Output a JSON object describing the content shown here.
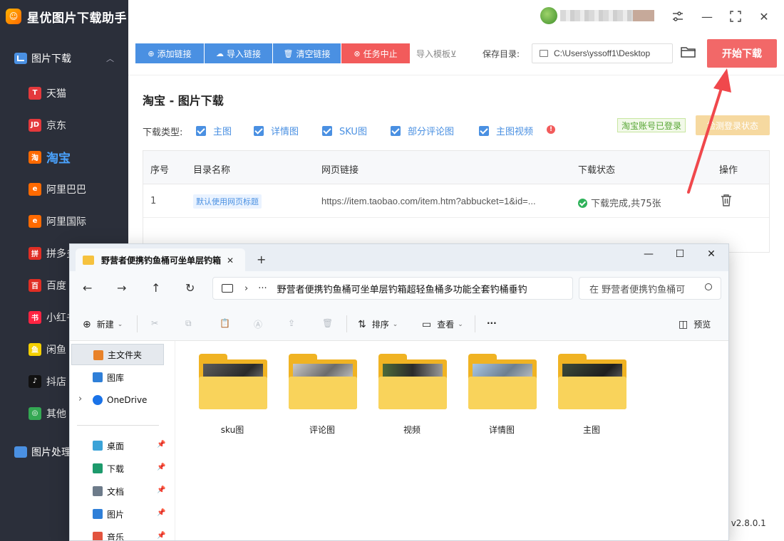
{
  "app": {
    "title": "星优图片下载助手",
    "version": "v2.8.0.1",
    "version_prefix": ":"
  },
  "sidebar": {
    "group_label": "图片下载",
    "items": [
      {
        "label": "天猫",
        "icon": "tmall-icon",
        "icon_text": "T",
        "color": "#e4393c"
      },
      {
        "label": "京东",
        "icon": "jd-icon",
        "icon_text": "JD",
        "color": "#e4393c"
      },
      {
        "label": "淘宝",
        "icon": "taobao-icon",
        "icon_text": "淘",
        "color": "#ff6a00"
      },
      {
        "label": "阿里巴巴",
        "icon": "alibaba-icon",
        "icon_text": "e",
        "color": "#ff6a00"
      },
      {
        "label": "阿里国际",
        "icon": "aliintl-icon",
        "icon_text": "e",
        "color": "#ff6a00"
      },
      {
        "label": "拼多多",
        "icon": "pdd-icon",
        "icon_text": "拼",
        "color": "#e02e24"
      },
      {
        "label": "百度",
        "icon": "baidu-icon",
        "icon_text": "百",
        "color": "#e02e24"
      },
      {
        "label": "小红书",
        "icon": "xhs-icon",
        "icon_text": "书",
        "color": "#ff2442"
      },
      {
        "label": "闲鱼",
        "icon": "xianyu-icon",
        "icon_text": "鱼",
        "color": "#f5d000"
      },
      {
        "label": "抖店",
        "icon": "douyin-icon",
        "icon_text": "♪",
        "color": "#111111"
      },
      {
        "label": "其他",
        "icon": "chrome-icon",
        "icon_text": "◎",
        "color": "#34a853"
      }
    ],
    "group2_label": "图片处理"
  },
  "toolbar": {
    "add_link": "添加链接",
    "import_link": "导入链接",
    "clear_link": "清空链接",
    "stop_task": "任务中止",
    "import_template": "导入模板⊻",
    "save_dir_label": "保存目录:",
    "save_dir_value": "C:\\Users\\yssoff1\\Desktop",
    "start_download": "开始下载"
  },
  "main": {
    "page_title": "淘宝 - 图片下载",
    "download_type_label": "下载类型:",
    "checkboxes": [
      {
        "label": "主图",
        "checked": true
      },
      {
        "label": "详情图",
        "checked": true
      },
      {
        "label": "SKU图",
        "checked": true
      },
      {
        "label": "部分评论图",
        "checked": true
      },
      {
        "label": "主图视频",
        "checked": true
      }
    ],
    "login_status": "淘宝账号已登录",
    "check_login": "检测登录状态",
    "table": {
      "headers": [
        "序号",
        "目录名称",
        "网页链接",
        "下载状态",
        "操作"
      ],
      "rows": [
        {
          "index": "1",
          "dir_name": "默认使用网页标题",
          "url": "https://item.taobao.com/item.htm?abbucket=1&id=...",
          "status": "下载完成,共75张"
        }
      ]
    }
  },
  "explorer": {
    "tab_title": "野营者便携钓鱼桶可坐单层钓箱",
    "address": "野营者便携钓鱼桶可坐单层钓箱超轻鱼桶多功能全套钓桶垂钓",
    "search_placeholder": "在 野营者便携钓鱼桶可",
    "cmd": {
      "new": "新建",
      "sort": "排序",
      "view": "查看",
      "more": "···",
      "preview": "预览"
    },
    "nav_pane": [
      {
        "label": "主文件夹",
        "icon": "home-icon",
        "selected": true
      },
      {
        "label": "图库",
        "icon": "gallery-icon"
      },
      {
        "label": "OneDrive",
        "icon": "onedrive-icon"
      },
      {
        "label": "桌面",
        "icon": "desktop-icon",
        "pinned": true
      },
      {
        "label": "下载",
        "icon": "download-icon",
        "pinned": true
      },
      {
        "label": "文档",
        "icon": "document-icon",
        "pinned": true
      },
      {
        "label": "图片",
        "icon": "picture-icon",
        "pinned": true
      },
      {
        "label": "音乐",
        "icon": "music-icon",
        "pinned": true
      }
    ],
    "folders": [
      "sku图",
      "评论图",
      "视频",
      "详情图",
      "主图"
    ]
  },
  "colors": {
    "sidebar_bg": "#2b2f3a",
    "accent_blue": "#4a90e2",
    "danger_red": "#f25b5b",
    "start_button": "#f26868",
    "success_green": "#2fb25a",
    "folder_yellow": "#f9d35b"
  }
}
